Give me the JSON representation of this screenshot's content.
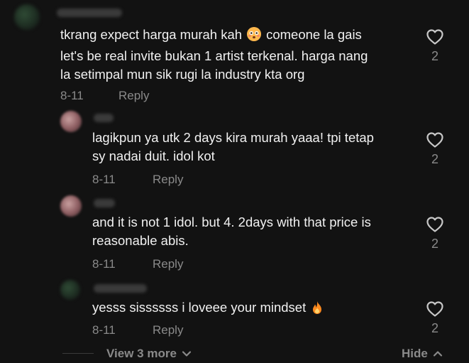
{
  "comments": [
    {
      "text_lines": [
        "tkrang expect harga murah kah",
        "let's be real invite bukan 1 artist terkenal. harga nang",
        "la setimpal mun sik rugi la industry kta org"
      ],
      "text_line1_suffix": "comeone la gais",
      "emoji": "flushed-face",
      "date": "8-11",
      "reply_label": "Reply",
      "like_count": "2"
    }
  ],
  "replies": [
    {
      "text_lines": [
        "lagikpun ya utk 2 days kira murah yaaa! tpi tetap",
        "sy nadai duit. idol kot"
      ],
      "date": "8-11",
      "reply_label": "Reply",
      "like_count": "2"
    },
    {
      "text_lines": [
        "and it is not 1 idol. but 4. 2days with that price is",
        "reasonable abis."
      ],
      "date": "8-11",
      "reply_label": "Reply",
      "like_count": "2"
    },
    {
      "text_lines": [
        "yesss sissssss i loveee your mindset"
      ],
      "emoji": "fire",
      "date": "8-11",
      "reply_label": "Reply",
      "like_count": "2"
    }
  ],
  "footer": {
    "view_more_label": "View 3 more",
    "hide_label": "Hide"
  },
  "colors": {
    "background": "#121212",
    "text": "#f1f1f1",
    "muted": "#8a8a8a",
    "fire": "#ff8a1f",
    "emoji_face": "#ffb84d"
  }
}
